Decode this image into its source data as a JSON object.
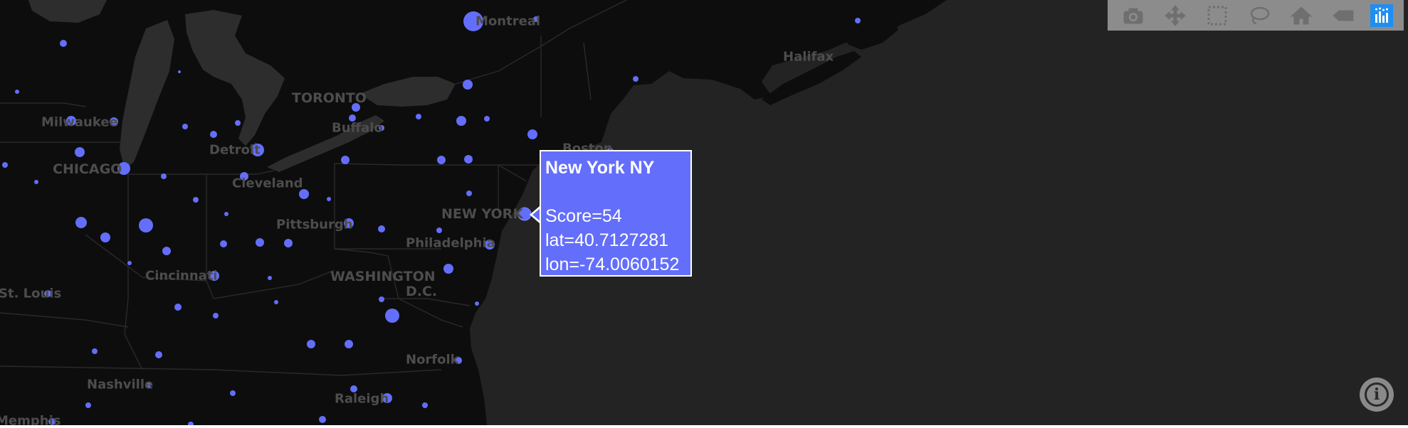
{
  "map": {
    "style": "dark",
    "colors": {
      "ocean": "#232323",
      "land": "#0d0d0d",
      "lakes": "#2d2d2d",
      "marker": "#636efa",
      "label": "#4d4d4d"
    },
    "city_labels": [
      "Montreal",
      "TORONTO",
      "Halifax",
      "Milwaukee",
      "CHICAGO",
      "Detroit",
      "Buffalo",
      "Boston",
      "Cleveland",
      "NEW YORK",
      "Pittsburgh",
      "Philadelphia",
      "WASHINGTON",
      "D.C.",
      "Cincinnati",
      "St. Louis",
      "Norfolk",
      "Nashville",
      "Raleigh",
      "Memphis"
    ]
  },
  "hover": {
    "title": "New York NY",
    "score": "Score=54",
    "lat": "lat=40.7127281",
    "lon": "lon=-74.0060152",
    "marker_score": 54
  },
  "modebar": {
    "buttons": [
      {
        "icon": "camera-icon",
        "name": "download-plot-button"
      },
      {
        "icon": "pan-icon",
        "name": "pan-button"
      },
      {
        "icon": "box-select-icon",
        "name": "box-select-button"
      },
      {
        "icon": "lasso-select-icon",
        "name": "lasso-select-button"
      },
      {
        "icon": "home-icon",
        "name": "reset-view-button"
      },
      {
        "icon": "hover-closest-icon",
        "name": "show-closest-button"
      },
      {
        "icon": "plotly-logo-icon",
        "name": "plotly-logo-button"
      }
    ]
  },
  "info_icon": "info-icon"
}
